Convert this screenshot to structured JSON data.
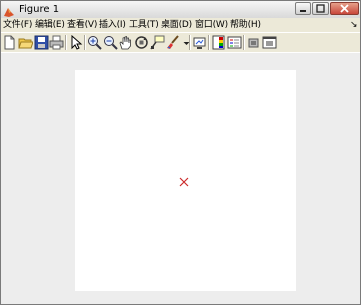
{
  "window": {
    "title": "Figure 1"
  },
  "menu": {
    "items": [
      {
        "label": "文件(F)"
      },
      {
        "label": "编辑(E)"
      },
      {
        "label": "查看(V)"
      },
      {
        "label": "插入(I)"
      },
      {
        "label": "工具(T)"
      },
      {
        "label": "桌面(D)"
      },
      {
        "label": "窗口(W)"
      },
      {
        "label": "帮助(H)"
      }
    ],
    "overflow": "↘"
  },
  "toolbar": {
    "icons": [
      "new-figure-icon",
      "open-file-icon",
      "save-icon",
      "print-icon",
      "edit-plot-arrow-icon",
      "zoom-in-icon",
      "zoom-out-icon",
      "pan-hand-icon",
      "rotate-3d-icon",
      "data-cursor-icon",
      "brush-icon",
      "link-plot-icon",
      "insert-colorbar-icon",
      "insert-legend-icon",
      "hide-plot-tools-icon",
      "show-plot-tools-icon"
    ]
  },
  "colors": {
    "marker": "#cc2b2b",
    "canvas": "#ffffff",
    "figure_background": "#ededed"
  },
  "plot": {
    "marker_symbol": "x"
  }
}
